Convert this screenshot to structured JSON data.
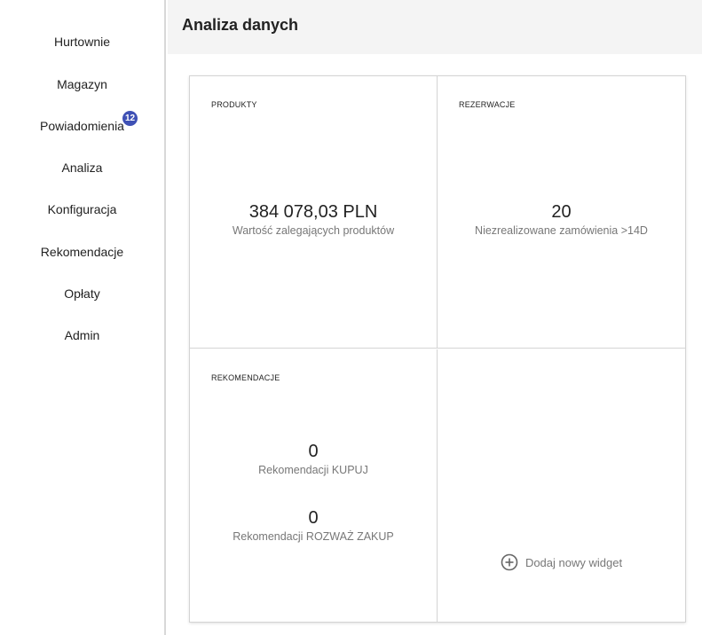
{
  "sidebar": {
    "items": [
      {
        "label": "Hurtownie"
      },
      {
        "label": "Magazyn"
      },
      {
        "label": "Powiadomienia",
        "badge": "12"
      },
      {
        "label": "Analiza"
      },
      {
        "label": "Konfiguracja"
      },
      {
        "label": "Rekomendacje"
      },
      {
        "label": "Opłaty"
      },
      {
        "label": "Admin"
      }
    ]
  },
  "header": {
    "title": "Analiza danych"
  },
  "widgets": {
    "produkty": {
      "title": "PRODUKTY",
      "value": "384 078,03 PLN",
      "label": "Wartość zalegających produktów"
    },
    "rezerwacje": {
      "title": "REZERWACJE",
      "value": "20",
      "label": "Niezrealizowane zamówienia >14D"
    },
    "rekomendacje": {
      "title": "REKOMENDACJE",
      "buy_value": "0",
      "buy_label": "Rekomendacji KUPUJ",
      "consider_value": "0",
      "consider_label": "Rekomendacji ROZWAŻ ZAKUP"
    },
    "add_widget": {
      "label": "Dodaj nowy widget",
      "icon": "plus-circle-icon"
    }
  },
  "colors": {
    "badge": "#3f51b5",
    "header_bg": "#f4f4f4"
  }
}
